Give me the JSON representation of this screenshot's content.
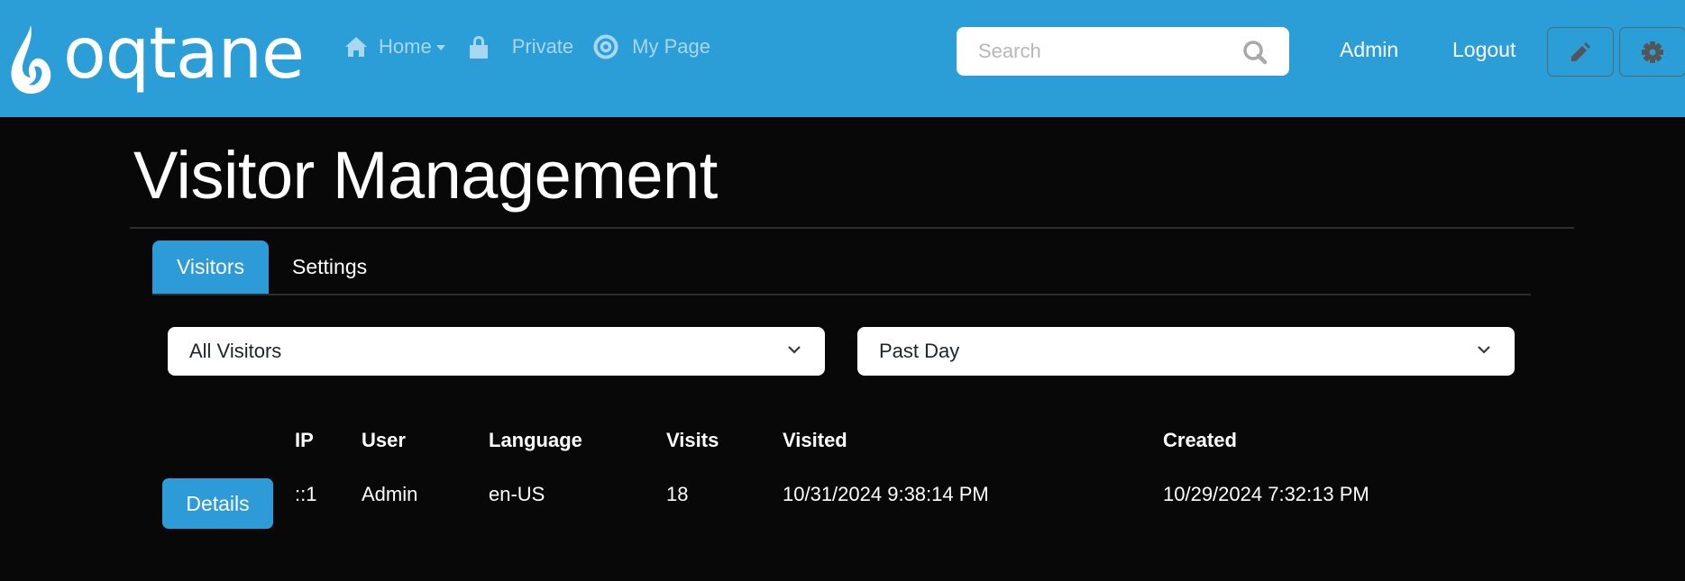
{
  "brand": {
    "name": "oqtane",
    "colors": {
      "header_bg": "#2b9ed7",
      "accent": "#2d9bd8",
      "page_bg": "#080808",
      "nav_text": "#a9d6f0"
    }
  },
  "nav": {
    "items": [
      {
        "label": "Home",
        "icon": "home-icon",
        "has_dropdown": true
      },
      {
        "label": "Private",
        "icon": "lock-icon",
        "has_dropdown": false
      },
      {
        "label": "My Page",
        "icon": "target-icon",
        "has_dropdown": false
      }
    ]
  },
  "search": {
    "placeholder": "Search",
    "value": "",
    "icon": "search-icon"
  },
  "header_links": {
    "admin": "Admin",
    "logout": "Logout"
  },
  "header_buttons": {
    "edit_icon": "pencil-icon",
    "settings_icon": "gear-icon"
  },
  "page": {
    "title": "Visitor Management"
  },
  "tabs": [
    {
      "label": "Visitors",
      "active": true
    },
    {
      "label": "Settings",
      "active": false
    }
  ],
  "filters": {
    "visitor_type": {
      "selected": "All Visitors"
    },
    "period": {
      "selected": "Past Day"
    }
  },
  "table": {
    "columns": [
      "IP",
      "User",
      "Language",
      "Visits",
      "Visited",
      "Created"
    ],
    "rows": [
      {
        "action_label": "Details",
        "ip": "::1",
        "user": "Admin",
        "language": "en-US",
        "visits": "18",
        "visited": "10/31/2024 9:38:14 PM",
        "created": "10/29/2024 7:32:13 PM"
      }
    ]
  }
}
